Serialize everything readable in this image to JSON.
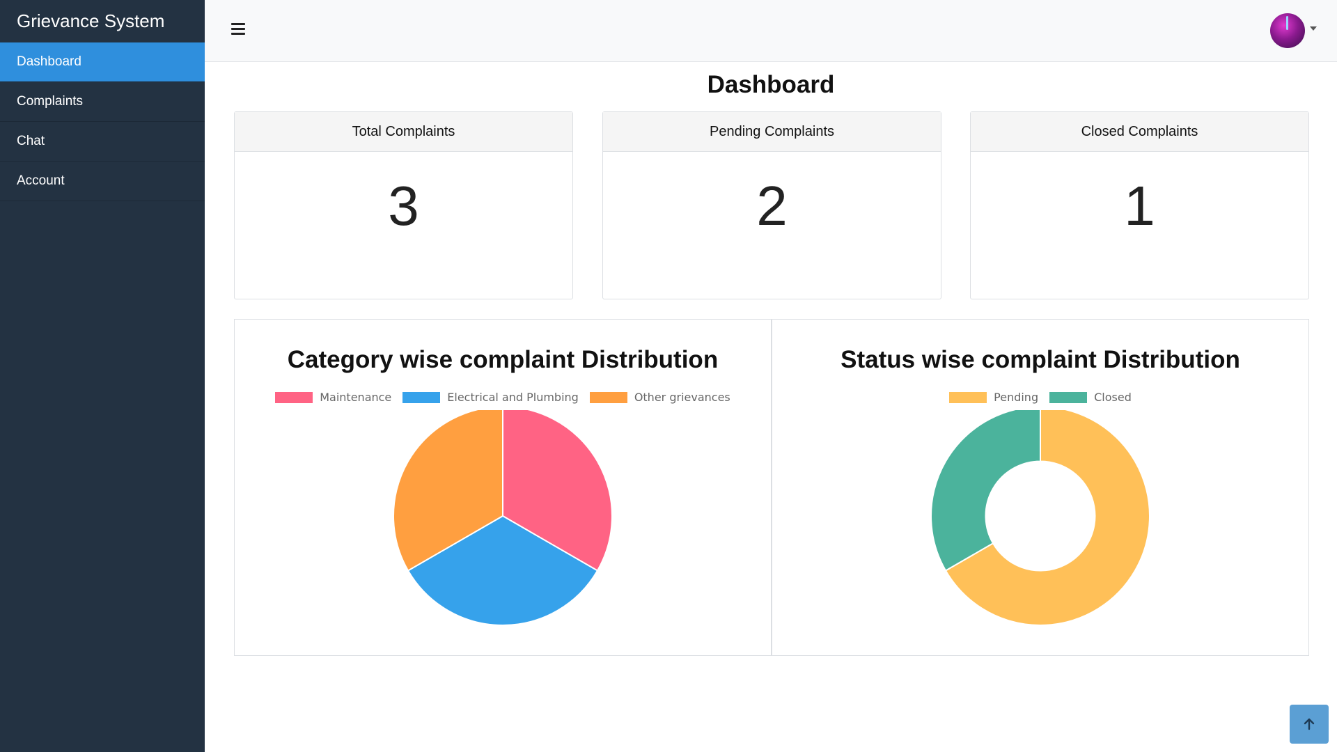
{
  "sidebar": {
    "brand": "Grievance System",
    "items": [
      {
        "label": "Dashboard",
        "active": true
      },
      {
        "label": "Complaints",
        "active": false
      },
      {
        "label": "Chat",
        "active": false
      },
      {
        "label": "Account",
        "active": false
      }
    ]
  },
  "topbar": {
    "menu_icon": "hamburger-menu-icon",
    "avatar_icon": "user-avatar",
    "dropdown_icon": "caret-down-icon"
  },
  "main": {
    "title": "Dashboard",
    "cards": [
      {
        "header": "Total Complaints",
        "value": "3"
      },
      {
        "header": "Pending Complaints",
        "value": "2"
      },
      {
        "header": "Closed Complaints",
        "value": "1"
      }
    ]
  },
  "chart_data": [
    {
      "type": "pie",
      "title": "Category wise complaint Distribution",
      "categories": [
        "Maintenance",
        "Electrical and Plumbing",
        "Other grievances"
      ],
      "values": [
        1,
        1,
        1
      ],
      "colors": [
        "#ff6384",
        "#36a2eb",
        "#ff9f40"
      ],
      "legend": "top"
    },
    {
      "type": "pie",
      "variant": "doughnut",
      "title": "Status wise complaint Distribution",
      "categories": [
        "Pending",
        "Closed"
      ],
      "values": [
        2,
        1
      ],
      "colors": [
        "#ffc058",
        "#4bb39c"
      ],
      "legend": "top"
    }
  ],
  "scroll_top_icon": "arrow-up-icon"
}
